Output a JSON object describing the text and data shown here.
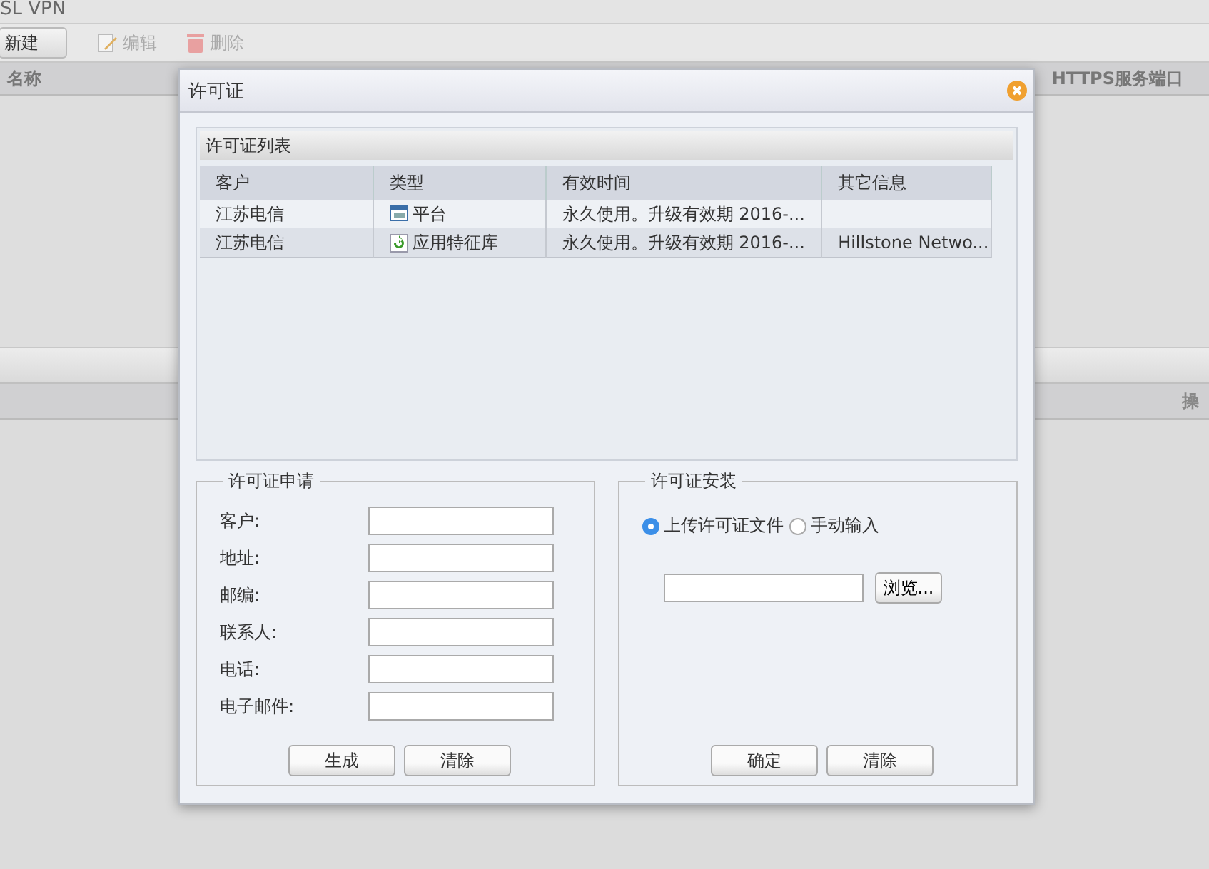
{
  "app": {
    "title": "SL VPN",
    "toolbar": [
      {
        "label": "新建",
        "kind": "button",
        "disabled": false
      },
      {
        "label": "编辑",
        "kind": "edit",
        "disabled": true
      },
      {
        "label": "删除",
        "kind": "delete",
        "disabled": true
      }
    ],
    "table_columns": [
      "名称",
      "HTTPS服务端口"
    ],
    "lower_columns": [
      "操"
    ]
  },
  "dialog": {
    "title": "许可证",
    "license_list": {
      "legend": "许可证列表",
      "columns": [
        "客户",
        "类型",
        "有效时间",
        "其它信息"
      ],
      "rows": [
        {
          "customer": "江苏电信",
          "type": "平台",
          "kind": "platform",
          "validity": "永久使用。升级有效期 2016-...",
          "info": ""
        },
        {
          "customer": "江苏电信",
          "type": "应用特征库",
          "kind": "signature",
          "validity": "永久使用。升级有效期 2016-...",
          "info": "Hillstone Netwo..."
        }
      ]
    },
    "request": {
      "legend": "许可证申请",
      "fields": [
        "客户:",
        "地址:",
        "邮编:",
        "联系人:",
        "电话:",
        "电子邮件:"
      ],
      "buttons": [
        "生成",
        "清除"
      ]
    },
    "install": {
      "legend": "许可证安装",
      "options": [
        {
          "label": "上传许可证文件",
          "selected": true
        },
        {
          "label": "手动输入",
          "selected": false
        }
      ],
      "browse": "浏览...",
      "buttons": [
        "确定",
        "清除"
      ]
    }
  }
}
